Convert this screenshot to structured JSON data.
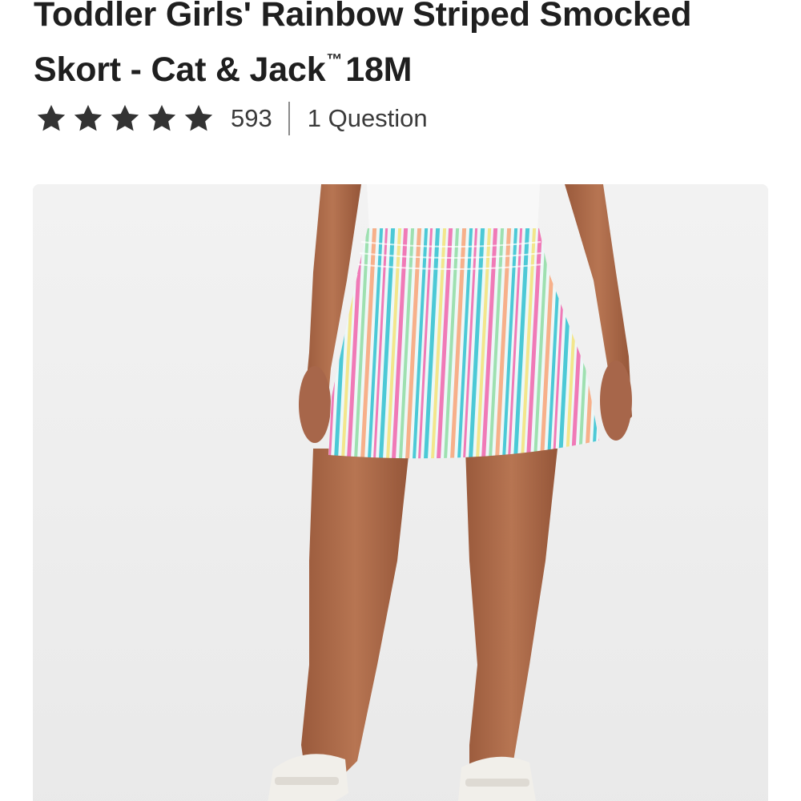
{
  "product": {
    "title": "Toddler Girls' Rainbow Striped Smocked Skort - Cat & Jack",
    "trademark": "™",
    "size": "18M"
  },
  "rating": {
    "stars": 5,
    "star_icon": "star-icon",
    "review_count": "593",
    "questions": "1 Question"
  },
  "image": {
    "subject": "product-photo",
    "colors": {
      "background": "#efefef",
      "shirt": "#f8f8f8",
      "skin": "#b06e4c",
      "sandal": "#f1efea",
      "stripe_teal": "#4cc9d6",
      "stripe_pink": "#f07ab7",
      "stripe_orange": "#f7b08a",
      "stripe_green": "#9ee0b0",
      "stripe_yellow": "#f3e68c"
    }
  },
  "colors": {
    "title_text": "#1f1f1f",
    "meta_text": "#3a3a3a",
    "star_fill": "#333333"
  }
}
